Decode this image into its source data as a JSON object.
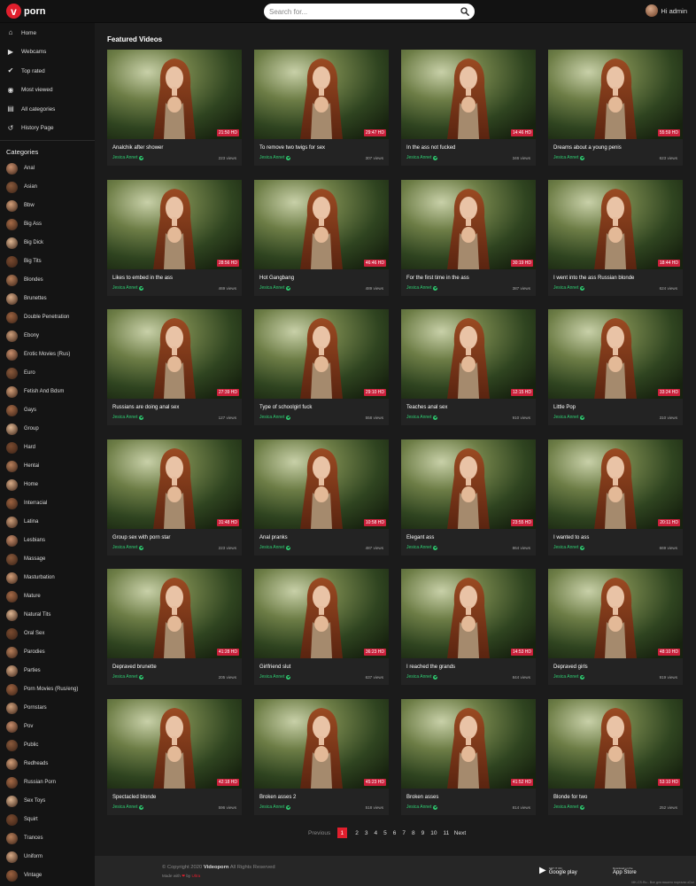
{
  "header": {
    "logo_letter": "v",
    "logo_text": "porn",
    "search_placeholder": "Search for...",
    "user_label": "Hi admin"
  },
  "sidebar": {
    "nav": [
      {
        "label": "Home",
        "icon": "home-icon"
      },
      {
        "label": "Webcams",
        "icon": "camera-icon"
      },
      {
        "label": "Top rated",
        "icon": "thumbs-up-icon"
      },
      {
        "label": "Most viewed",
        "icon": "eye-icon"
      },
      {
        "label": "All categories",
        "icon": "folder-icon"
      },
      {
        "label": "History Page",
        "icon": "history-icon"
      }
    ],
    "categories_title": "Categories",
    "categories": [
      "Anal",
      "Asian",
      "Bbw",
      "Big Ass",
      "Big Dick",
      "Big Tits",
      "Blondes",
      "Brunettes",
      "Double Penetration",
      "Ebony",
      "Erotic Movies (Rus)",
      "Euro",
      "Fetish And Bdsm",
      "Gays",
      "Group",
      "Hard",
      "Hentai",
      "Home",
      "Interracial",
      "Latina",
      "Lesbians",
      "Massage",
      "Masturbation",
      "Mature",
      "Natural Tits",
      "Oral Sex",
      "Parodies",
      "Parties",
      "Porn Movies (Rus/eng)",
      "Pornstars",
      "Pov",
      "Public",
      "Redheads",
      "Russian Porn",
      "Sex Toys",
      "Squirt",
      "Trances",
      "Uniform",
      "Vintage"
    ]
  },
  "main": {
    "title": "Featured Videos",
    "videos": [
      {
        "title": "Analchik after shower",
        "author": "Jesica Annet",
        "views": "223 views",
        "duration": "21:50 HD"
      },
      {
        "title": "To remove two twigs for sex",
        "author": "Jesica Annet",
        "views": "307 views",
        "duration": "29:47 HD"
      },
      {
        "title": "In the ass not fucked",
        "author": "Jesica Annet",
        "views": "346 views",
        "duration": "14:46 HD"
      },
      {
        "title": "Dreams about a young penis",
        "author": "Jesica Annet",
        "views": "623 views",
        "duration": "55:59 HD"
      },
      {
        "title": "Likes to embed in the ass",
        "author": "Jesica Annet",
        "views": "469 views",
        "duration": "28:56 HD"
      },
      {
        "title": "Hot Gangbang",
        "author": "Jesica Annet",
        "views": "489 views",
        "duration": "46:46 HD"
      },
      {
        "title": "For the first time in the ass",
        "author": "Jesica Annet",
        "views": "387 views",
        "duration": "30:19 HD"
      },
      {
        "title": "I went into the ass Russian blonde",
        "author": "Jesica Annet",
        "views": "624 views",
        "duration": "18:44 HD"
      },
      {
        "title": "Russians are doing anal sex",
        "author": "Jesica Annet",
        "views": "127 views",
        "duration": "27:39 HD"
      },
      {
        "title": "Type of schoolgirl fuck",
        "author": "Jesica Annet",
        "views": "558 views",
        "duration": "29:10 HD"
      },
      {
        "title": "Teaches anal sex",
        "author": "Jesica Annet",
        "views": "910 views",
        "duration": "12:15 HD"
      },
      {
        "title": "Little Pop",
        "author": "Jesica Annet",
        "views": "310 views",
        "duration": "33:24 HD"
      },
      {
        "title": "Group sex with porn star",
        "author": "Jesica Annet",
        "views": "223 views",
        "duration": "31:48 HD"
      },
      {
        "title": "Anal pranks",
        "author": "Jesica Annet",
        "views": "487 views",
        "duration": "10:58 HD"
      },
      {
        "title": "Elegant ass",
        "author": "Jesica Annet",
        "views": "864 views",
        "duration": "23:55 HD"
      },
      {
        "title": "I wanted to ass",
        "author": "Jesica Annet",
        "views": "669 views",
        "duration": "20:11 HD"
      },
      {
        "title": "Depraved brunette",
        "author": "Jesica Annet",
        "views": "205 views",
        "duration": "41:28 HD"
      },
      {
        "title": "Girlfriend slut",
        "author": "Jesica Annet",
        "views": "637 views",
        "duration": "36:23 HD"
      },
      {
        "title": "I reached the grands",
        "author": "Jesica Annet",
        "views": "844 views",
        "duration": "14:53 HD"
      },
      {
        "title": "Depraved girls",
        "author": "Jesica Annet",
        "views": "919 views",
        "duration": "48:10 HD"
      },
      {
        "title": "Spectacled blonde",
        "author": "Jesica Annet",
        "views": "596 views",
        "duration": "42:18 HD"
      },
      {
        "title": "Broken asses 2",
        "author": "Jesica Annet",
        "views": "518 views",
        "duration": "45:23 HD"
      },
      {
        "title": "Broken asses",
        "author": "Jesica Annet",
        "views": "814 views",
        "duration": "41:52 HD"
      },
      {
        "title": "Blonde for two",
        "author": "Jesica Annet",
        "views": "252 views",
        "duration": "53:10 HD"
      }
    ]
  },
  "pagination": {
    "previous": "Previous",
    "pages": [
      "1",
      "2",
      "3",
      "4",
      "5",
      "6",
      "7",
      "8",
      "9",
      "10",
      "11"
    ],
    "current": "1",
    "next": "Next"
  },
  "footer": {
    "copyright_prefix": "© Copyright 2020",
    "brand": "Videoporn",
    "copyright_suffix": "All Rights Reserved",
    "made_with": "Made with",
    "by": "by",
    "author": "Ultra",
    "google_small": "GET IT ON",
    "google_big": "Google play",
    "apple_small": "Download on the",
    "apple_big": "App Store",
    "ucoz": "MK-CS.Ru - Все для вашего портала uCoz"
  },
  "colors": {
    "accent": "#e01f2d",
    "verified": "#2ecc71",
    "background": "#1b1b1b"
  }
}
